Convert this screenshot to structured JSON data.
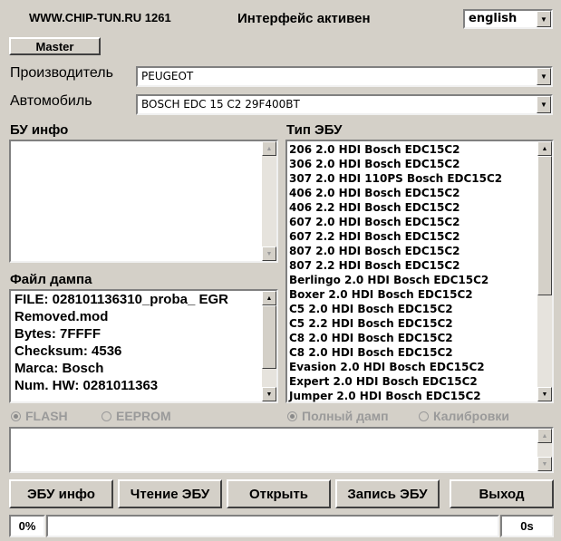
{
  "header": {
    "site": "WWW.CHIP-TUN.RU 1261",
    "status": "Интерфейс активен",
    "language": "english"
  },
  "master_label": "Master",
  "manufacturer": {
    "label": "Производитель",
    "value": "PEUGEOT"
  },
  "car": {
    "label": "Автомобиль",
    "value": "BOSCH EDC 15 C2 29F400BT"
  },
  "ecu_info": {
    "label": "БУ инфо"
  },
  "ecu_type": {
    "label": "Тип ЭБУ",
    "items": [
      "206 2.0 HDI Bosch EDC15C2",
      "306 2.0 HDI Bosch EDC15C2",
      "307 2.0 HDI 110PS Bosch EDC15C2",
      "406 2.0 HDI Bosch EDC15C2",
      "406 2.2 HDI Bosch EDC15C2",
      "607 2.0 HDI Bosch EDC15C2",
      "607 2.2 HDI Bosch EDC15C2",
      "807 2.0 HDI Bosch EDC15C2",
      "807 2.2 HDI Bosch EDC15C2",
      "Berlingo 2.0 HDI Bosch EDC15C2",
      "Boxer 2.0 HDI Bosch EDC15C2",
      "C5 2.0 HDI Bosch EDC15C2",
      "C5 2.2 HDI Bosch EDC15C2",
      "C8 2.0 HDI Bosch EDC15C2",
      "C8 2.0 HDI Bosch EDC15C2",
      "Evasion 2.0 HDI Bosch EDC15C2",
      "Expert 2.0 HDI Bosch EDC15C2",
      "Jumper 2.0 HDI Bosch EDC15C2"
    ]
  },
  "dump": {
    "label": "Файл дампа",
    "lines": [
      "FILE: 028101136310_proba_ EGR",
      "Removed.mod",
      "Bytes: 7FFFF",
      "Checksum: 4536",
      "Marca: Bosch",
      "Num. HW: 0281011363"
    ]
  },
  "radios": {
    "flash": "FLASH",
    "eeprom": "EEPROM",
    "full_dump": "Полный дамп",
    "calibrations": "Калибровки"
  },
  "buttons": {
    "ecu_info": "ЭБУ инфо",
    "read": "Чтение ЭБУ",
    "open": "Открыть",
    "write": "Запись ЭБУ",
    "exit": "Выход"
  },
  "progress": {
    "percent_label": "0%",
    "value": 0,
    "time": "0s"
  }
}
